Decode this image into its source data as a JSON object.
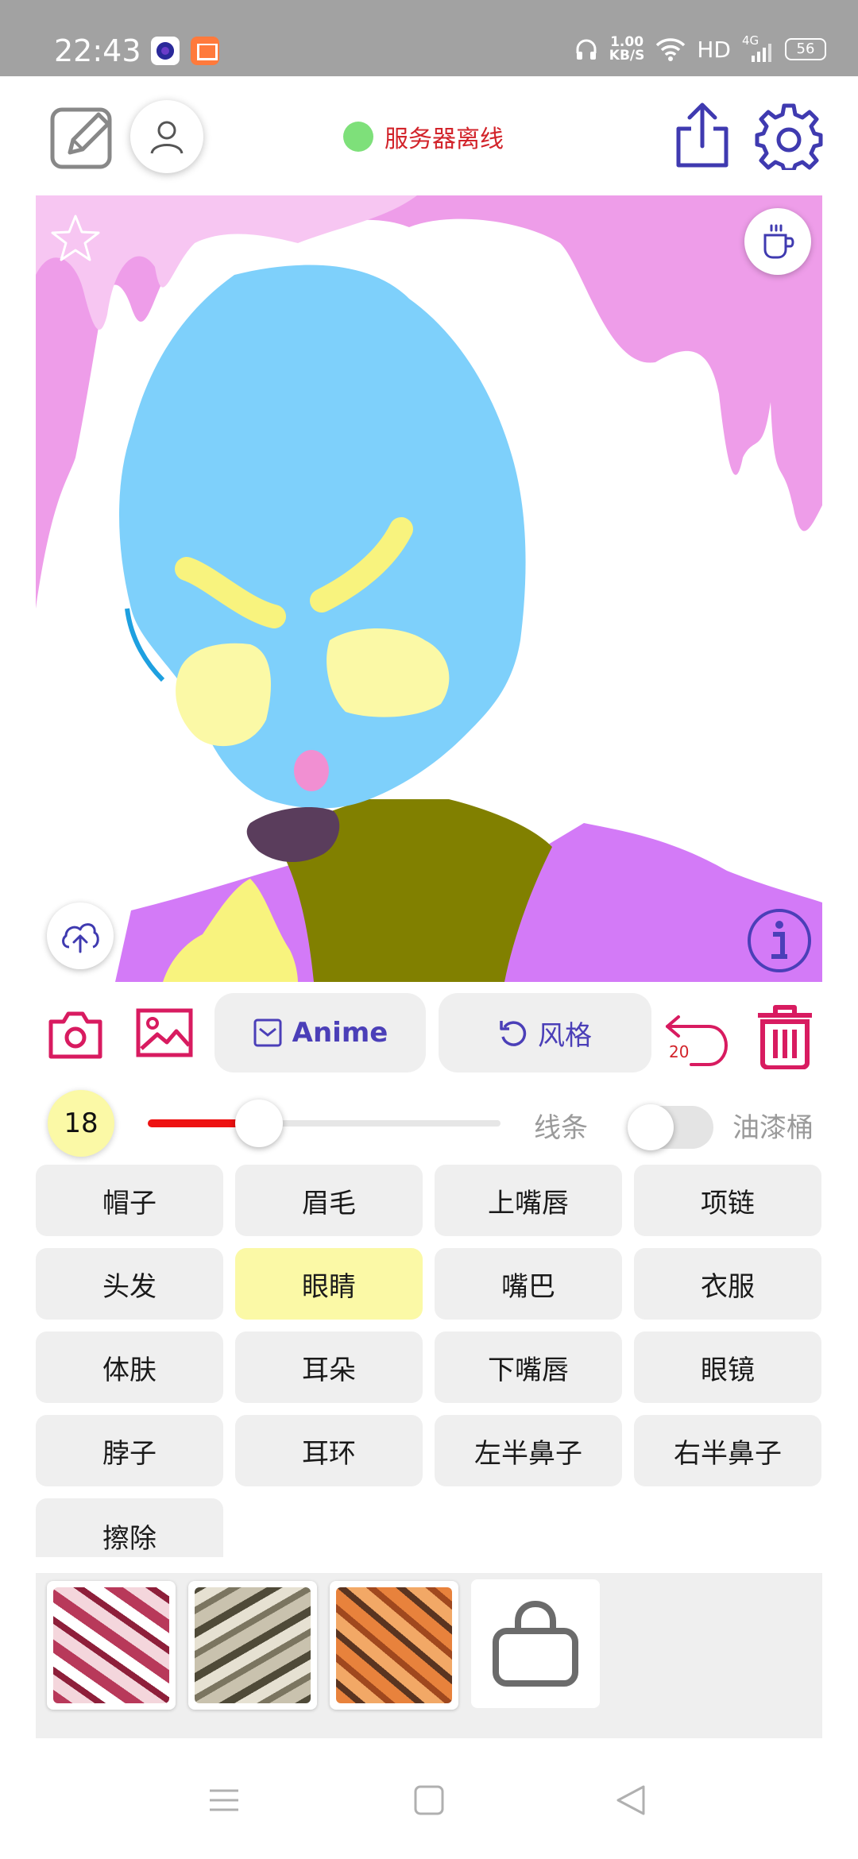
{
  "status_bar": {
    "time": "22:43",
    "net_speed_value": "1.00",
    "net_speed_unit": "KB/S",
    "network": "HD",
    "cell": "4G",
    "battery": "56"
  },
  "header": {
    "server_status": "服务器离线",
    "server_dot_color": "#7ee07a",
    "icons": [
      "edit-icon",
      "user-icon",
      "share-icon",
      "gear-icon"
    ]
  },
  "toolbar": {
    "anime_label": "Anime",
    "style_label": "风格",
    "undo_count": "20",
    "accent_color": "#4b3fb8",
    "danger_color": "#d81b60"
  },
  "brush": {
    "size": "18",
    "slider_fraction": 0.27,
    "line_label": "线条",
    "bucket_label": "油漆桶",
    "bucket_enabled": false
  },
  "parts": {
    "items": [
      {
        "label": "帽子"
      },
      {
        "label": "眉毛"
      },
      {
        "label": "上嘴唇"
      },
      {
        "label": "项链"
      },
      {
        "label": "头发"
      },
      {
        "label": "眼睛"
      },
      {
        "label": "嘴巴"
      },
      {
        "label": "衣服"
      },
      {
        "label": "体肤"
      },
      {
        "label": "耳朵"
      },
      {
        "label": "下嘴唇"
      },
      {
        "label": "眼镜"
      },
      {
        "label": "脖子"
      },
      {
        "label": "耳环"
      },
      {
        "label": "左半鼻子"
      },
      {
        "label": "右半鼻子"
      },
      {
        "label": "擦除"
      }
    ],
    "selected": "眼睛"
  },
  "canvas_colors": {
    "hair": "#ee9de9",
    "skin": "#7ed0fb",
    "eyes": "#fbf9a6",
    "brows": "#f8f37e",
    "nose": "#f18fd2",
    "mouth": "#5a3d5c",
    "neck": "#818000",
    "clothes": "#d37af7"
  }
}
